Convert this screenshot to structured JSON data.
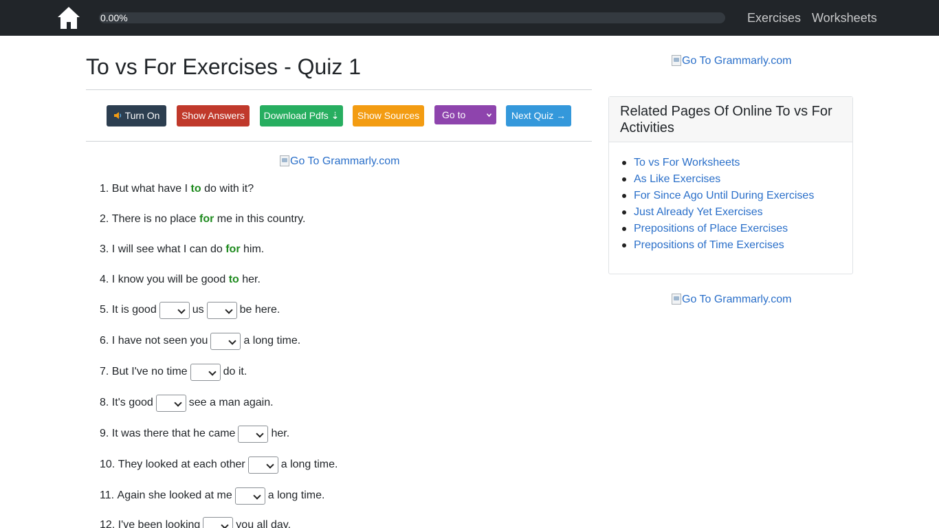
{
  "nav": {
    "progress_text": "0.00%",
    "progress_value": 0.0,
    "links": [
      "Exercises",
      "Worksheets"
    ]
  },
  "page": {
    "title": "To vs For Exercises - Quiz 1"
  },
  "toolbar": {
    "turn_on": "Turn On",
    "show_answers": "Show Answers",
    "download_pdfs": "Download Pdfs ⇣",
    "show_sources": "Show Sources",
    "goto": "Go to",
    "next_quiz": "Next Quiz →"
  },
  "ad_alt": "Go To Grammarly.com",
  "questions": [
    {
      "num": "1.",
      "before": "But what have I",
      "answer": "to",
      "after": "do with it?"
    },
    {
      "num": "2.",
      "before": "There is no place",
      "answer": "for",
      "after": "me in this country."
    },
    {
      "num": "3.",
      "before": "I will see what I can do",
      "answer": "for",
      "after": "him."
    },
    {
      "num": "4.",
      "before": "I know you will be good",
      "answer": "to",
      "after": "her."
    },
    {
      "num": "5.",
      "a": "It is good",
      "b": "us",
      "c": "be here."
    },
    {
      "num": "6.",
      "a": "I have not seen you",
      "b": "a long time."
    },
    {
      "num": "7.",
      "a": "But I've no time",
      "b": "do it."
    },
    {
      "num": "8.",
      "a": "It's good",
      "b": "see a man again."
    },
    {
      "num": "9.",
      "a": "It was there that he came",
      "b": "her."
    },
    {
      "num": "10.",
      "a": "They looked at each other",
      "b": "a long time."
    },
    {
      "num": "11.",
      "a": "Again she looked at me",
      "b": "a long time."
    },
    {
      "num": "12.",
      "a": "I've been looking",
      "b": "you all day."
    }
  ],
  "sidebar": {
    "title": "Related Pages Of Online To vs For Activities",
    "links": [
      "To vs For Worksheets",
      "As Like Exercises",
      "For Since Ago Until During Exercises",
      "Just Already Yet Exercises",
      "Prepositions of Place Exercises",
      "Prepositions of Time Exercises"
    ]
  },
  "colors": {
    "navbar": "#212529",
    "turn_on": "#2c3e50",
    "show_answers": "#c0392b",
    "download": "#27ae60",
    "sources": "#f39c12",
    "goto": "#8e44ad",
    "next": "#3498db",
    "answer_green": "#1e8a1e"
  }
}
